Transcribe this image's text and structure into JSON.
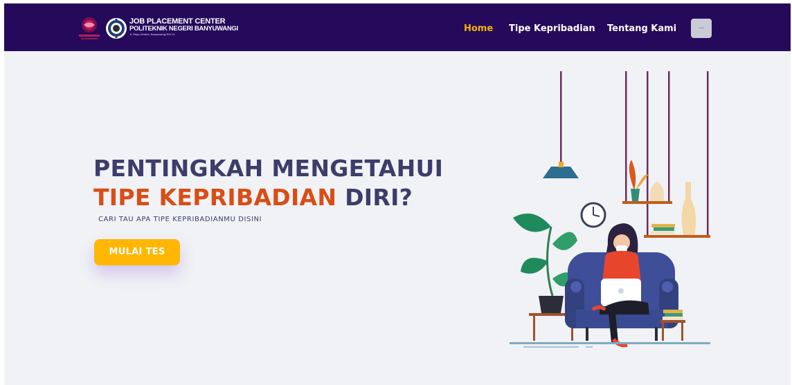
{
  "header": {
    "logo_text": {
      "line1": "JOB PLACEMENT CENTER",
      "line2": "POLITEKNIK NEGERI BANYUWANGI",
      "line3": "Jl. Raya Jember, Banyuwangi KM 13"
    },
    "nav": [
      {
        "label": "Home",
        "active": true
      },
      {
        "label": "Tipe Kepribadian",
        "active": false
      },
      {
        "label": "Tentang Kami",
        "active": false
      }
    ],
    "icons": {
      "logo1": "circle-emblem-logo",
      "logo2": "gear-emblem-logo",
      "user": "user-menu-button"
    }
  },
  "hero": {
    "title_line1": "PENTINGKAH MENGETAHUI",
    "title_accent": "TIPE KEPRIBADIAN",
    "title_rest": " DIRI?",
    "subtitle": "CARI TAU APA TIPE KEPRIBADIANMU DISINI",
    "cta_label": "MULAI TES"
  },
  "theme": {
    "navbar_bg": "#250a5c",
    "active_link": "#f5b400",
    "heading_color": "#3d3d6b",
    "accent_color": "#d84e16",
    "cta_color": "#ffb703"
  }
}
